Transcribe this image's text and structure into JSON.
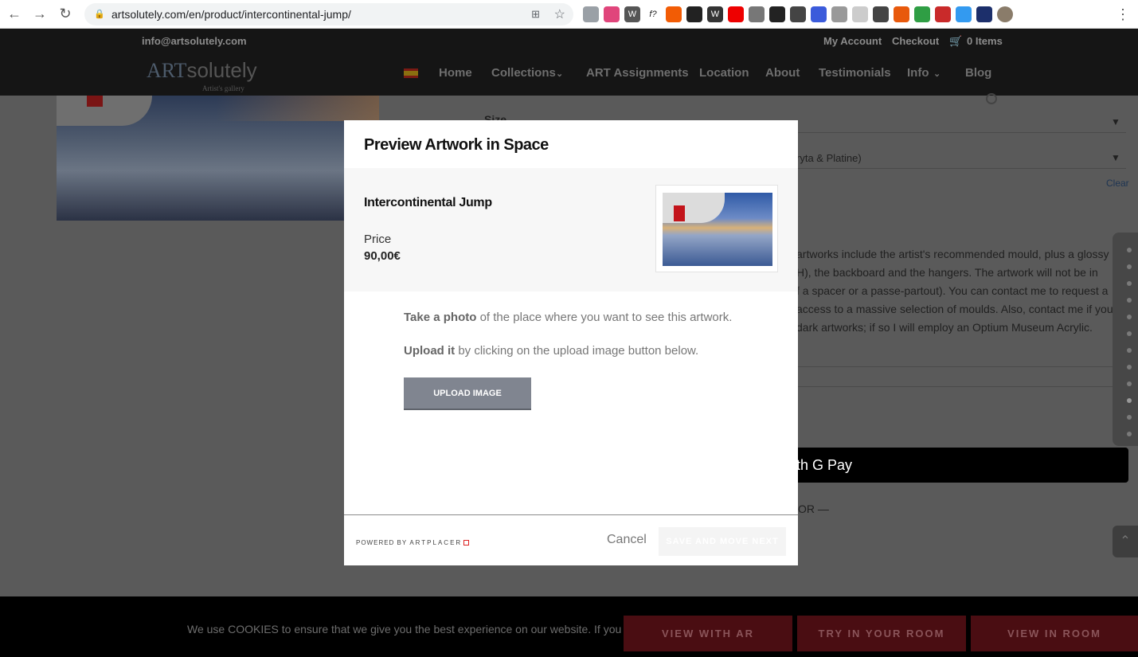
{
  "browser": {
    "url": "artsolutely.com/en/product/intercontinental-jump/"
  },
  "site": {
    "email": "info@artsolutely.com",
    "my_account": "My Account",
    "checkout": "Checkout",
    "cart": "0 Items",
    "logo_main": "ART",
    "logo_sub": "solutely",
    "logo_tag": "Artist's gallery",
    "nav": [
      "Home",
      "Collections",
      "ART Assignments",
      "Location",
      "About",
      "Testimonials",
      "Info",
      "Blog"
    ]
  },
  "background": {
    "size_label": "Size",
    "finish_text": "ryta & Platine)",
    "clear_link": "Clear",
    "desc_lines": [
      "artworks include the artist's recommended mould, plus a glossy",
      "H), the backboard and the hangers. The artwork will not be in",
      "f a spacer or a passe-partout). You can contact me to request a",
      "access to a massive selection of moulds. Also, contact me if you",
      "dark artworks; if so I will employ an Optium Museum Acrylic."
    ],
    "gpay_text": "th G Pay",
    "or_text": "OR —"
  },
  "modal": {
    "title": "Preview Artwork in Space",
    "product_name": "Intercontinental Jump",
    "price_label": "Price",
    "price_value": "90,00€",
    "instr1_bold": "Take a photo",
    "instr1_rest": " of the place where you want to see this artwork.",
    "instr2_bold": "Upload it",
    "instr2_rest": " by clicking on the upload image button below.",
    "upload_button": "UPLOAD IMAGE",
    "powered_by": "POWERED BY ",
    "powered_brand": "ARTPLACER",
    "cancel": "Cancel",
    "save_button": "SAVE AND MOVE NEXT"
  },
  "cookie": {
    "message": "We use COOKIES to ensure that we give you the best experience on our website. If you continu"
  },
  "ar_buttons": [
    "VIEW WITH AR",
    "TRY IN YOUR ROOM",
    "VIEW IN ROOM"
  ]
}
